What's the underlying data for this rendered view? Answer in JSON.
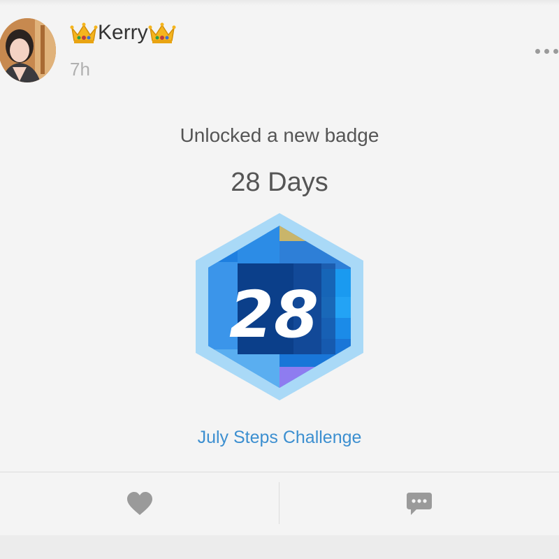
{
  "post": {
    "author": "Kerry",
    "time": "7h",
    "headline": "Unlocked a new badge",
    "badge_title": "28 Days",
    "badge_number": "28",
    "challenge_link": "July Steps Challenge"
  },
  "icons": {
    "crown_left": "crown-emoji",
    "crown_right": "crown-emoji",
    "more": "more-dots-icon",
    "like": "heart-icon",
    "comment": "comment-bubble-icon"
  },
  "colors": {
    "link": "#3c8fd0",
    "badge_outer": "#a9d9f7",
    "badge_inner": "#1e7fe0",
    "icon_gray": "#9a9a9a"
  }
}
